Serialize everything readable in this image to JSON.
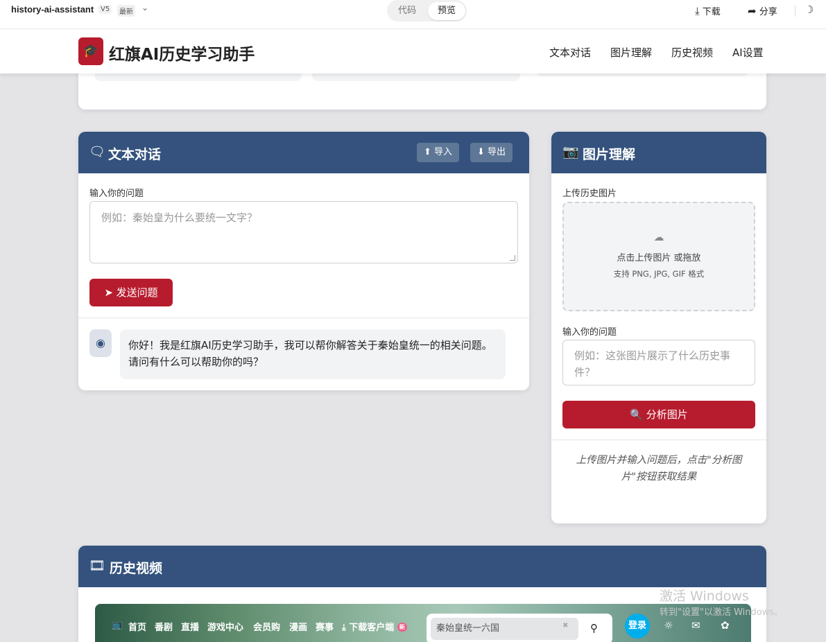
{
  "topbar": {
    "project": "history-ai-assistant",
    "version": "V5",
    "latest": "最新",
    "tab_code": "代码",
    "tab_preview": "预览",
    "download": "下载",
    "share": "分享"
  },
  "header": {
    "brand": "红旗AI历史学习助手",
    "nav": [
      "文本对话",
      "图片理解",
      "历史视频",
      "AI设置"
    ]
  },
  "text_chat": {
    "title": "文本对话",
    "import_label": "导入",
    "export_label": "导出",
    "question_label": "输入你的问题",
    "question_placeholder": "例如：秦始皇为什么要统一文字？",
    "send_label": "发送问题",
    "assistant_message": "你好！我是红旗AI历史学习助手，我可以帮你解答关于秦始皇统一的相关问题。请问有什么可以帮助你的吗？"
  },
  "image_understanding": {
    "title": "图片理解",
    "upload_label": "上传历史图片",
    "upload_prompt": "点击上传图片 或拖放",
    "upload_formats": "支持 PNG, JPG, GIF 格式",
    "question_label": "输入你的问题",
    "question_placeholder": "例如：这张图片展示了什么历史事件？",
    "analyze_label": "分析图片",
    "result_hint": "上传图片并输入问题后，点击\"分析图片\"按钮获取结果"
  },
  "history_video": {
    "title": "历史视频",
    "embed_nav": [
      "首页",
      "番剧",
      "直播",
      "游戏中心",
      "会员购",
      "漫画",
      "赛事",
      "下载客户端"
    ],
    "embed_new_badge": "新",
    "embed_search_value": "秦始皇统一六国",
    "embed_login": "登录"
  },
  "watermark": {
    "line1": "激活 Windows",
    "line2": "转到\"设置\"以激活 Windows。"
  },
  "colors": {
    "primary": "#34527d",
    "accent_red": "#b71c2e",
    "background": "#f4f4f5"
  }
}
